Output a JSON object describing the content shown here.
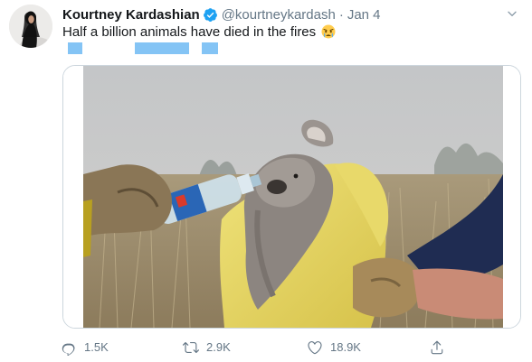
{
  "tweet": {
    "author_name": "Kourtney Kardashian",
    "handle": "@kourtneykardash",
    "separator": "·",
    "date": "Jan 4",
    "text": "Half a billion animals have died in the fires",
    "emoji": "crying-face-emoji"
  },
  "media": {
    "image_name": "koala-drinking-from-bottle-photo"
  },
  "actions": {
    "reply_count": "1.5K",
    "retweet_count": "2.9K",
    "like_count": "18.9K"
  },
  "icons": {
    "verified": "verified-badge-icon",
    "caret": "chevron-down-icon",
    "reply": "reply-icon",
    "retweet": "retweet-icon",
    "like": "heart-icon",
    "share": "share-icon"
  },
  "colors": {
    "verified_blue": "#1da1f2",
    "secondary_text": "#657786",
    "translate_highlight": "#5bb0f2",
    "border": "#ccd6dd"
  }
}
